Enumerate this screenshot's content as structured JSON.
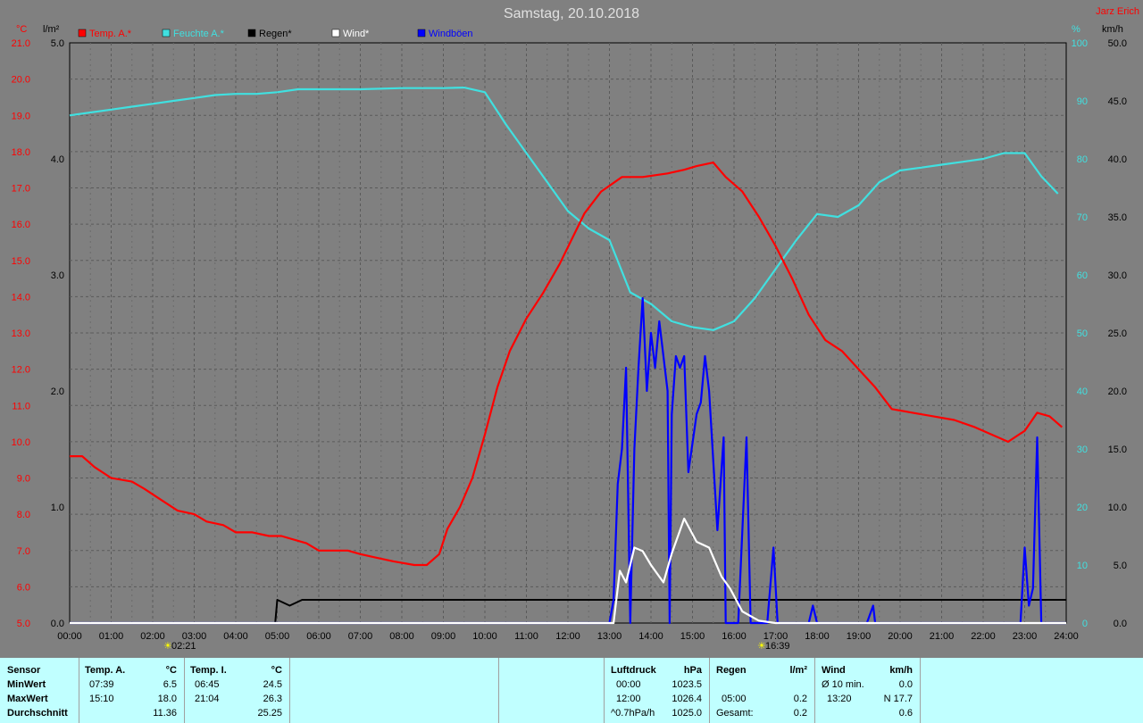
{
  "title": "Samstag, 20.10.2018",
  "author": "Jarz Erich",
  "units": {
    "temp": "°C",
    "rain": "l/m²",
    "pressure": "hPa",
    "wind": "km/h"
  },
  "legend": [
    {
      "label": "Temp. A.*",
      "color": "#ff0000"
    },
    {
      "label": "Feuchte A.*",
      "color": "#40e0e0"
    },
    {
      "label": "Regen*",
      "color": "#000000"
    },
    {
      "label": "Wind*",
      "color": "#ffffff"
    },
    {
      "label": "Windböen",
      "color": "#0000ff"
    }
  ],
  "sun_markers": {
    "sunrise": "02:21",
    "sunset": "16:39"
  },
  "chart_data": {
    "type": "line",
    "title": "Samstag, 20.10.2018",
    "x_ticks": [
      "00:00",
      "01:00",
      "02:00",
      "03:00",
      "04:00",
      "05:00",
      "06:00",
      "07:00",
      "08:00",
      "09:00",
      "10:00",
      "11:00",
      "12:00",
      "13:00",
      "14:00",
      "15:00",
      "16:00",
      "17:00",
      "18:00",
      "19:00",
      "20:00",
      "21:00",
      "22:00",
      "23:00",
      "24:00"
    ],
    "axes": {
      "temp": {
        "label": "°C",
        "min": 5.0,
        "max": 21.0,
        "ticks": [
          "5.0",
          "6.0",
          "7.0",
          "8.0",
          "9.0",
          "10.0",
          "11.0",
          "12.0",
          "13.0",
          "14.0",
          "15.0",
          "16.0",
          "17.0",
          "18.0",
          "19.0",
          "20.0",
          "21.0"
        ]
      },
      "rain": {
        "label": "l/m²",
        "min": 0,
        "max": 5.0,
        "ticks": [
          "0.0",
          "1.0",
          "2.0",
          "3.0",
          "4.0",
          "5.0"
        ]
      },
      "humidity": {
        "label": "%",
        "min": 0,
        "max": 100,
        "ticks": [
          "0",
          "10",
          "20",
          "30",
          "40",
          "50",
          "60",
          "70",
          "80",
          "90",
          "100"
        ]
      },
      "wind": {
        "label": "km/h",
        "min": 0,
        "max": 50,
        "ticks": [
          "0.0",
          "5.0",
          "10.0",
          "15.0",
          "20.0",
          "25.0",
          "30.0",
          "35.0",
          "40.0",
          "45.0",
          "50.0"
        ]
      }
    },
    "grid": true,
    "series": [
      {
        "name": "Temp. A.*",
        "axis": "temp",
        "color": "#ff0000",
        "points": [
          [
            0,
            9.6
          ],
          [
            0.3,
            9.6
          ],
          [
            0.6,
            9.3
          ],
          [
            1,
            9.0
          ],
          [
            1.5,
            8.9
          ],
          [
            1.8,
            8.7
          ],
          [
            2.2,
            8.4
          ],
          [
            2.6,
            8.1
          ],
          [
            3,
            8.0
          ],
          [
            3.3,
            7.8
          ],
          [
            3.7,
            7.7
          ],
          [
            4.0,
            7.5
          ],
          [
            4.4,
            7.5
          ],
          [
            4.8,
            7.4
          ],
          [
            5.1,
            7.4
          ],
          [
            5.4,
            7.3
          ],
          [
            5.7,
            7.2
          ],
          [
            6.0,
            7.0
          ],
          [
            6.3,
            7.0
          ],
          [
            6.7,
            7.0
          ],
          [
            7.0,
            6.9
          ],
          [
            7.4,
            6.8
          ],
          [
            7.8,
            6.7
          ],
          [
            8.3,
            6.6
          ],
          [
            8.6,
            6.6
          ],
          [
            8.9,
            6.9
          ],
          [
            9.1,
            7.6
          ],
          [
            9.4,
            8.2
          ],
          [
            9.7,
            9.0
          ],
          [
            10.0,
            10.2
          ],
          [
            10.3,
            11.5
          ],
          [
            10.6,
            12.5
          ],
          [
            11.0,
            13.4
          ],
          [
            11.4,
            14.1
          ],
          [
            11.8,
            14.9
          ],
          [
            12.1,
            15.6
          ],
          [
            12.4,
            16.3
          ],
          [
            12.8,
            16.9
          ],
          [
            13.3,
            17.3
          ],
          [
            13.8,
            17.3
          ],
          [
            14.4,
            17.4
          ],
          [
            14.8,
            17.5
          ],
          [
            15.1,
            17.6
          ],
          [
            15.5,
            17.7
          ],
          [
            15.8,
            17.3
          ],
          [
            16.2,
            16.9
          ],
          [
            16.6,
            16.2
          ],
          [
            17.0,
            15.4
          ],
          [
            17.4,
            14.5
          ],
          [
            17.8,
            13.5
          ],
          [
            18.2,
            12.8
          ],
          [
            18.6,
            12.5
          ],
          [
            19.0,
            12.0
          ],
          [
            19.4,
            11.5
          ],
          [
            19.8,
            10.9
          ],
          [
            20.3,
            10.8
          ],
          [
            20.8,
            10.7
          ],
          [
            21.3,
            10.6
          ],
          [
            21.8,
            10.4
          ],
          [
            22.2,
            10.2
          ],
          [
            22.6,
            10.0
          ],
          [
            23.0,
            10.3
          ],
          [
            23.3,
            10.8
          ],
          [
            23.6,
            10.7
          ],
          [
            23.9,
            10.4
          ]
        ]
      },
      {
        "name": "Feuchte A.*",
        "axis": "humidity",
        "color": "#40e0e0",
        "points": [
          [
            0,
            87.5
          ],
          [
            0.5,
            88
          ],
          [
            1,
            88.5
          ],
          [
            1.5,
            89
          ],
          [
            2,
            89.5
          ],
          [
            2.5,
            90
          ],
          [
            3,
            90.5
          ],
          [
            3.5,
            91
          ],
          [
            4,
            91.2
          ],
          [
            4.5,
            91.2
          ],
          [
            5,
            91.5
          ],
          [
            5.5,
            92
          ],
          [
            6,
            92
          ],
          [
            7,
            92
          ],
          [
            8,
            92.2
          ],
          [
            9,
            92.2
          ],
          [
            9.5,
            92.3
          ],
          [
            10,
            91.5
          ],
          [
            10.5,
            86
          ],
          [
            11,
            81
          ],
          [
            11.5,
            76
          ],
          [
            12,
            71
          ],
          [
            12.5,
            68
          ],
          [
            13,
            66
          ],
          [
            13.5,
            57
          ],
          [
            14,
            55
          ],
          [
            14.5,
            52
          ],
          [
            15,
            51
          ],
          [
            15.5,
            50.5
          ],
          [
            16,
            52
          ],
          [
            16.5,
            56
          ],
          [
            17,
            61
          ],
          [
            17.5,
            66
          ],
          [
            18,
            70.5
          ],
          [
            18.5,
            70
          ],
          [
            19,
            72
          ],
          [
            19.5,
            76
          ],
          [
            20,
            78
          ],
          [
            20.5,
            78.5
          ],
          [
            21,
            79
          ],
          [
            21.5,
            79.5
          ],
          [
            22,
            80
          ],
          [
            22.5,
            81
          ],
          [
            23,
            81
          ],
          [
            23.4,
            77
          ],
          [
            23.8,
            74
          ]
        ]
      },
      {
        "name": "Regen*",
        "axis": "rain",
        "color": "#000000",
        "points": [
          [
            0,
            0
          ],
          [
            4.95,
            0
          ],
          [
            5.0,
            0.2
          ],
          [
            5.3,
            0.15
          ],
          [
            5.6,
            0.2
          ],
          [
            6.0,
            0.2
          ],
          [
            24,
            0.2
          ]
        ]
      },
      {
        "name": "Wind*",
        "axis": "wind",
        "color": "#ffffff",
        "points": [
          [
            0,
            0
          ],
          [
            13.1,
            0
          ],
          [
            13.25,
            4.5
          ],
          [
            13.4,
            3.5
          ],
          [
            13.6,
            6.5
          ],
          [
            13.8,
            6.2
          ],
          [
            14.0,
            5.0
          ],
          [
            14.3,
            3.5
          ],
          [
            14.5,
            6.0
          ],
          [
            14.8,
            9.0
          ],
          [
            15.1,
            7.0
          ],
          [
            15.4,
            6.5
          ],
          [
            15.7,
            4.0
          ],
          [
            15.9,
            3.0
          ],
          [
            16.2,
            1.0
          ],
          [
            16.6,
            0.2
          ],
          [
            17.0,
            0
          ],
          [
            24,
            0
          ]
        ]
      },
      {
        "name": "Windböen",
        "axis": "wind",
        "color": "#0000ff",
        "points": [
          [
            0,
            0
          ],
          [
            13.0,
            0
          ],
          [
            13.1,
            2.0
          ],
          [
            13.2,
            12.0
          ],
          [
            13.3,
            15.0
          ],
          [
            13.4,
            22.0
          ],
          [
            13.5,
            0
          ],
          [
            13.6,
            15.0
          ],
          [
            13.7,
            22.0
          ],
          [
            13.8,
            28.0
          ],
          [
            13.9,
            20.0
          ],
          [
            14.0,
            25.0
          ],
          [
            14.1,
            22.0
          ],
          [
            14.2,
            26.0
          ],
          [
            14.4,
            20.0
          ],
          [
            14.45,
            0
          ],
          [
            14.5,
            18.0
          ],
          [
            14.6,
            23.0
          ],
          [
            14.7,
            22.0
          ],
          [
            14.8,
            23.0
          ],
          [
            14.9,
            13.0
          ],
          [
            15.1,
            18.0
          ],
          [
            15.2,
            19.0
          ],
          [
            15.3,
            23.0
          ],
          [
            15.4,
            20.0
          ],
          [
            15.6,
            8.0
          ],
          [
            15.75,
            16.0
          ],
          [
            15.8,
            0
          ],
          [
            16.1,
            0
          ],
          [
            16.3,
            16.0
          ],
          [
            16.4,
            0
          ],
          [
            16.8,
            0
          ],
          [
            16.95,
            6.5
          ],
          [
            17.05,
            0
          ],
          [
            17.8,
            0
          ],
          [
            17.9,
            1.5
          ],
          [
            18.0,
            0
          ],
          [
            19.2,
            0
          ],
          [
            19.35,
            1.5
          ],
          [
            19.4,
            0
          ],
          [
            22.9,
            0
          ],
          [
            23.0,
            6.5
          ],
          [
            23.1,
            1.5
          ],
          [
            23.2,
            3.0
          ],
          [
            23.3,
            16.0
          ],
          [
            23.4,
            0
          ],
          [
            24,
            0
          ]
        ]
      }
    ]
  },
  "table": {
    "sensor": {
      "header": "Sensor",
      "rows": [
        "MinWert",
        "MaxWert",
        "Durchschnitt"
      ]
    },
    "temp_a": {
      "header": "Temp. A.",
      "unit": "°C",
      "times": [
        "07:39",
        "15:10",
        ""
      ],
      "values": [
        "6.5",
        "18.0",
        "11.36"
      ]
    },
    "temp_i": {
      "header": "Temp. I.",
      "unit": "°C",
      "times": [
        "06:45",
        "21:04",
        ""
      ],
      "values": [
        "24.5",
        "26.3",
        "25.25"
      ]
    },
    "pressure": {
      "header": "Luftdruck",
      "unit": "hPa",
      "times": [
        "00:00",
        "12:00",
        "^0.7hPa/h"
      ],
      "values": [
        "1023.5",
        "1026.4",
        "1025.0"
      ]
    },
    "rain": {
      "header": "Regen",
      "unit": "l/m²",
      "times": [
        "",
        "05:00",
        "Gesamt:"
      ],
      "values": [
        "",
        "0.2",
        "0.2"
      ]
    },
    "wind": {
      "header": "Wind",
      "unit": "km/h",
      "times": [
        "Ø 10 min.",
        "13:20",
        ""
      ],
      "values": [
        "0.0",
        "N 17.7",
        "0.6"
      ]
    }
  }
}
